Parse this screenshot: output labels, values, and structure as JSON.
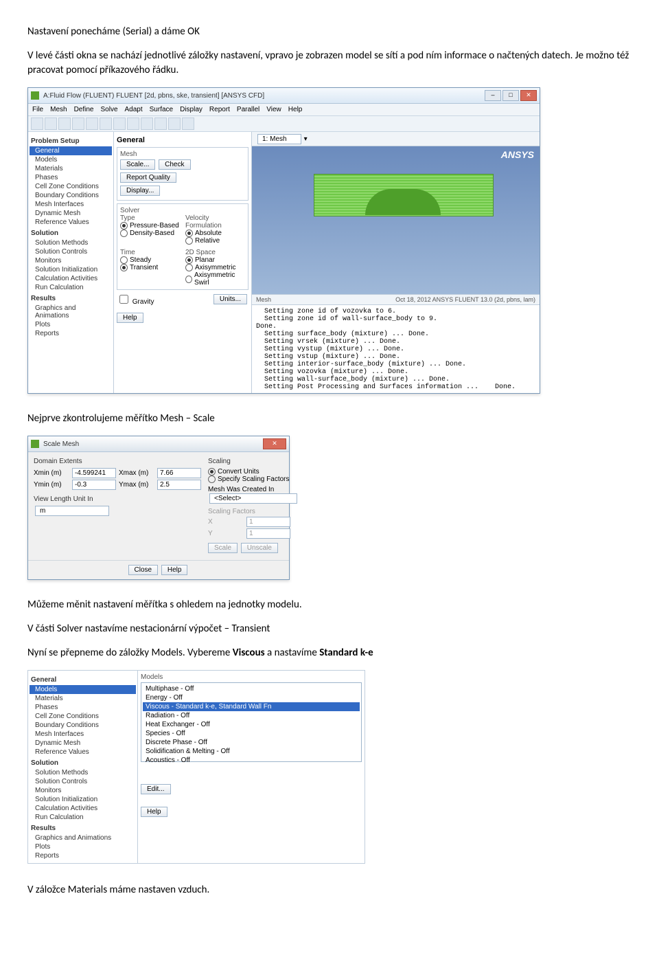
{
  "doc": {
    "p1": "Nastavení ponecháme (Serial) a dáme OK",
    "p2": "V levé části okna se nachází jednotlivé záložky nastavení, vpravo je zobrazen model se sítí a pod ním informace o načtených datech. Je možno též pracovat pomocí příkazového řádku.",
    "p3": "Nejprve zkontrolujeme měřítko Mesh – Scale",
    "p4": "Můžeme měnit nastavení měřítka s ohledem na jednotky modelu.",
    "p5": "V části Solver nastavíme nestacionární výpočet – Transient",
    "p6_a": "Nyní se přepneme do záložky Models. Vybereme ",
    "p6_b": "Viscous",
    "p6_c": " a nastavíme ",
    "p6_d": "Standard k-e",
    "p7": "V záložce Materials máme nastaven vzduch."
  },
  "fluent": {
    "title": "A:Fluid Flow (FLUENT) FLUENT [2d, pbns, ske, transient] [ANSYS CFD]",
    "menu": [
      "File",
      "Mesh",
      "Define",
      "Solve",
      "Adapt",
      "Surface",
      "Display",
      "Report",
      "Parallel",
      "View",
      "Help"
    ],
    "nav_header": "Problem Setup",
    "nav_items": [
      "General",
      "Models",
      "Materials",
      "Phases",
      "Cell Zone Conditions",
      "Boundary Conditions",
      "Mesh Interfaces",
      "Dynamic Mesh",
      "Reference Values"
    ],
    "nav_solution_hdr": "Solution",
    "nav_solution": [
      "Solution Methods",
      "Solution Controls",
      "Monitors",
      "Solution Initialization",
      "Calculation Activities",
      "Run Calculation"
    ],
    "nav_results_hdr": "Results",
    "nav_results": [
      "Graphics and Animations",
      "Plots",
      "Reports"
    ],
    "taskpage": {
      "title": "General",
      "mesh_label": "Mesh",
      "scale_btn": "Scale...",
      "check_btn": "Check",
      "report_btn": "Report Quality",
      "display_btn": "Display...",
      "solver_label": "Solver",
      "type_label": "Type",
      "vf_label": "Velocity Formulation",
      "type_opts": [
        "Pressure-Based",
        "Density-Based"
      ],
      "vf_opts": [
        "Absolute",
        "Relative"
      ],
      "time_label": "Time",
      "space_label": "2D Space",
      "time_opts": [
        "Steady",
        "Transient"
      ],
      "space_opts": [
        "Planar",
        "Axisymmetric",
        "Axisymmetric Swirl"
      ],
      "gravity": "Gravity",
      "units_btn": "Units...",
      "help_btn": "Help"
    },
    "view_dropdown": "1: Mesh",
    "ansys": "ANSYS",
    "status_left": "Mesh",
    "status_right": "Oct 18, 2012  ANSYS FLUENT 13.0 (2d, pbns, lam)",
    "console": [
      "  Setting zone id of vozovka to 6.",
      "  Setting zone id of wall-surface_body to 9.",
      "Done.",
      "",
      "  Setting surface_body (mixture) ... Done.",
      "  Setting vrsek (mixture) ... Done.",
      "  Setting vystup (mixture) ... Done.",
      "  Setting vstup (mixture) ... Done.",
      "  Setting interior-surface_body (mixture) ... Done.",
      "  Setting vozovka (mixture) ... Done.",
      "  Setting wall-surface_body (mixture) ... Done.",
      "",
      "  Setting Post Processing and Surfaces information ...    Done."
    ]
  },
  "scale_dlg": {
    "title": "Scale Mesh",
    "domain_h": "Domain Extents",
    "xmin_l": "Xmin (m)",
    "xmin_v": "-4.599241",
    "xmax_l": "Xmax (m)",
    "xmax_v": "7.66",
    "ymin_l": "Ymin (m)",
    "ymin_v": "-0.3",
    "ymax_l": "Ymax (m)",
    "ymax_v": "2.5",
    "viewunit_l": "View Length Unit In",
    "viewunit_v": "m",
    "scaling_h": "Scaling",
    "r1": "Convert Units",
    "r2": "Specify Scaling Factors",
    "created_l": "Mesh Was Created In",
    "created_v": "<Select>",
    "sf_l": "Scaling Factors",
    "xf_l": "X",
    "xf_v": "1",
    "yf_l": "Y",
    "yf_v": "1",
    "scale_btn": "Scale",
    "unscale_btn": "Unscale",
    "close_btn": "Close",
    "help_btn": "Help"
  },
  "models": {
    "nav_header": "General",
    "nav_items": [
      "Models",
      "Materials",
      "Phases",
      "Cell Zone Conditions",
      "Boundary Conditions",
      "Mesh Interfaces",
      "Dynamic Mesh",
      "Reference Values"
    ],
    "nav_solution_hdr": "Solution",
    "nav_solution": [
      "Solution Methods",
      "Solution Controls",
      "Monitors",
      "Solution Initialization",
      "Calculation Activities",
      "Run Calculation"
    ],
    "nav_results_hdr": "Results",
    "nav_results": [
      "Graphics and Animations",
      "Plots",
      "Reports"
    ],
    "list_h": "Models",
    "rows": [
      "Multiphase - Off",
      "Energy - Off",
      "Viscous - Standard k-e, Standard Wall Fn",
      "Radiation - Off",
      "Heat Exchanger - Off",
      "Species - Off",
      "Discrete Phase - Off",
      "Solidification & Melting - Off",
      "Acoustics - Off"
    ],
    "edit_btn": "Edit...",
    "help_btn": "Help"
  }
}
